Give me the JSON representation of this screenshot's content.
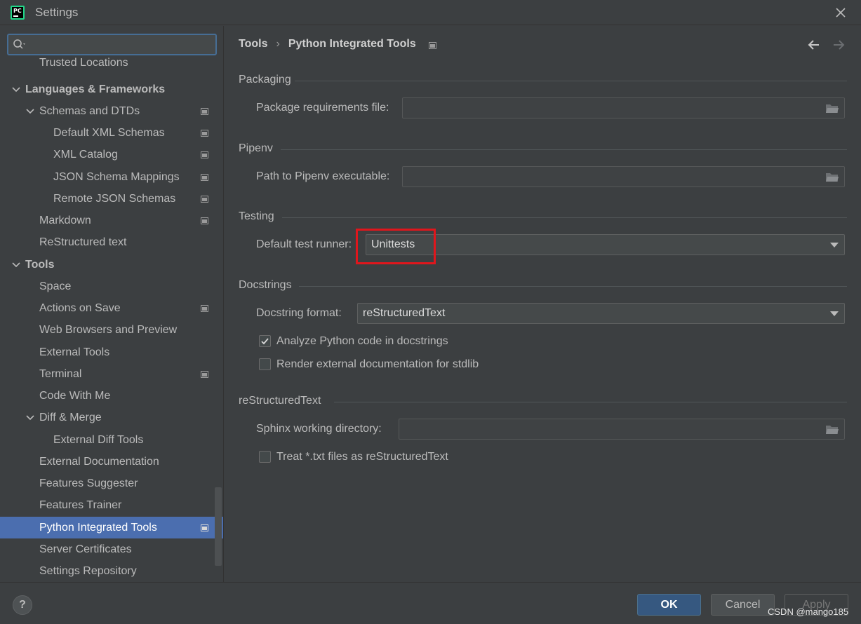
{
  "window": {
    "title": "Settings",
    "app_icon_text": "PC"
  },
  "search": {
    "placeholder": "",
    "value": ""
  },
  "sidebar": {
    "items": [
      {
        "label": "Trusted Locations"
      },
      {
        "label": "Languages & Frameworks"
      },
      {
        "label": "Schemas and DTDs"
      },
      {
        "label": "Default XML Schemas"
      },
      {
        "label": "XML Catalog"
      },
      {
        "label": "JSON Schema Mappings"
      },
      {
        "label": "Remote JSON Schemas"
      },
      {
        "label": "Markdown"
      },
      {
        "label": "ReStructured text"
      },
      {
        "label": "Tools"
      },
      {
        "label": "Space"
      },
      {
        "label": "Actions on Save"
      },
      {
        "label": "Web Browsers and Preview"
      },
      {
        "label": "External Tools"
      },
      {
        "label": "Terminal"
      },
      {
        "label": "Code With Me"
      },
      {
        "label": "Diff & Merge"
      },
      {
        "label": "External Diff Tools"
      },
      {
        "label": "External Documentation"
      },
      {
        "label": "Features Suggester"
      },
      {
        "label": "Features Trainer"
      },
      {
        "label": "Python Integrated Tools"
      },
      {
        "label": "Server Certificates"
      },
      {
        "label": "Settings Repository"
      }
    ],
    "selected": "Python Integrated Tools"
  },
  "breadcrumb": {
    "parent": "Tools",
    "separator": "›",
    "current": "Python Integrated Tools"
  },
  "packaging": {
    "title": "Packaging",
    "requirements_label": "Package requirements file:",
    "requirements_value": ""
  },
  "pipenv": {
    "title": "Pipenv",
    "path_label": "Path to Pipenv executable:",
    "path_value": ""
  },
  "testing": {
    "title": "Testing",
    "runner_label": "Default test runner:",
    "runner_value": "Unittests"
  },
  "docstrings": {
    "title": "Docstrings",
    "format_label": "Docstring format:",
    "format_value": "reStructuredText",
    "analyze_label": "Analyze Python code in docstrings",
    "analyze_checked": true,
    "render_label": "Render external documentation for stdlib",
    "render_checked": false
  },
  "restructuredtext": {
    "title": "reStructuredText",
    "sphinx_label": "Sphinx working directory:",
    "sphinx_value": "",
    "treat_txt_label": "Treat *.txt files as reStructuredText",
    "treat_txt_checked": false
  },
  "footer": {
    "help_label": "?",
    "ok_label": "OK",
    "cancel_label": "Cancel",
    "apply_label": "Apply",
    "watermark": "CSDN @mango185"
  },
  "colors": {
    "selection": "#4b6eaf",
    "highlight_box": "#e0161c",
    "ok_button": "#365880"
  }
}
